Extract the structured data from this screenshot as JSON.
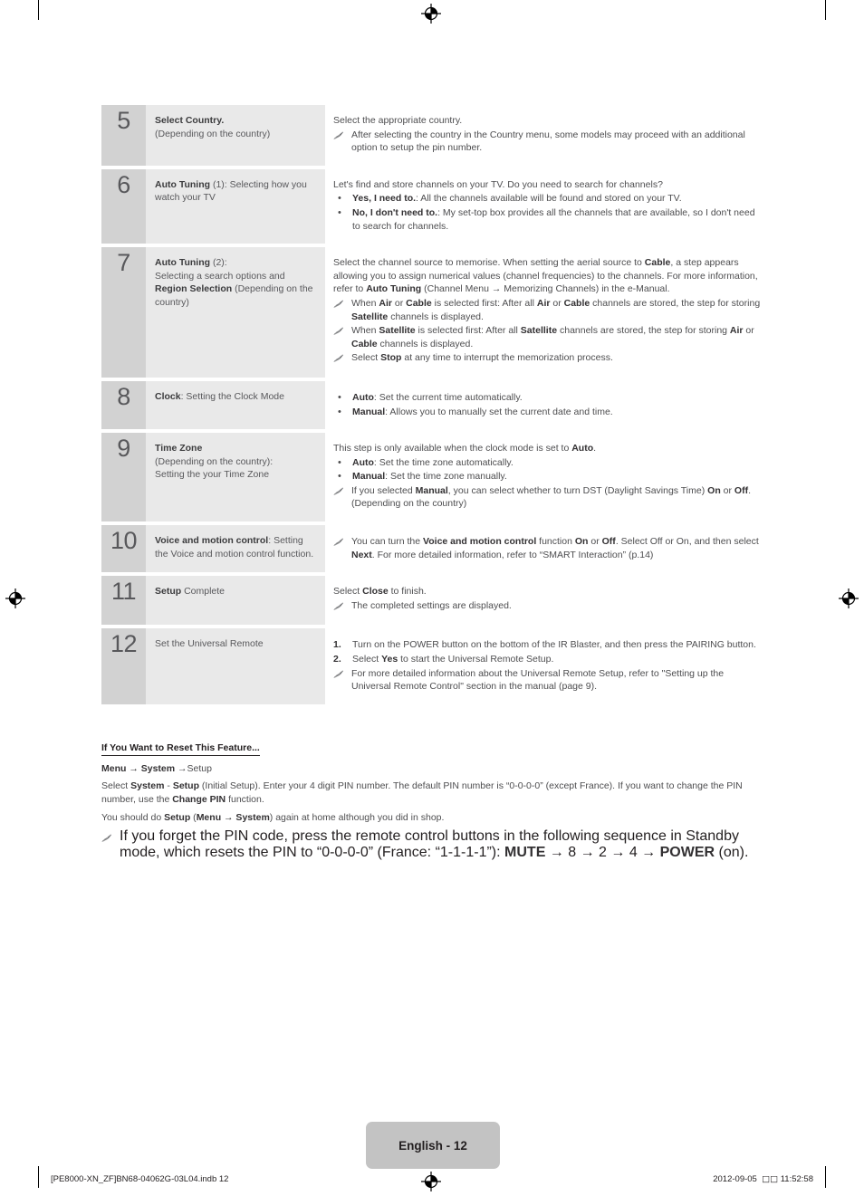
{
  "page": {
    "footer_tab_label": "English - 12",
    "footer_left": "[PE8000-XN_ZF]BN68-04062G-03L04.indb   12",
    "footer_right_date": "2012-09-05",
    "footer_right_tofu": "□□",
    "footer_right_time": "11:52:58"
  },
  "icons": {
    "note": "note-pencil-icon",
    "registration": "registration-mark-icon",
    "crop": "crop-mark-icon"
  },
  "steps": [
    {
      "number": "5",
      "label_lines": [
        {
          "bold": "Select Country.",
          "rest": ""
        },
        {
          "bold": "",
          "rest": "(Depending on the country)"
        }
      ],
      "desc": {
        "lead": "Select the appropriate country.",
        "notes": [
          "After selecting the country in the Country menu, some models may proceed with an additional option to setup the pin number."
        ]
      }
    },
    {
      "number": "6",
      "label_lines": [
        {
          "bold": "Auto Tuning",
          "rest": " (1): Selecting how you watch your TV"
        }
      ],
      "desc": {
        "lead": "Let's find and store channels on your TV. Do you need to search for channels?",
        "bullets": [
          {
            "bold": "Yes, I need to.",
            "rest": ": All the channels available will be found and stored on your TV."
          },
          {
            "bold": "No, I don't need to.",
            "rest": ": My set-top box provides all the channels that are available, so I don't need to search for channels."
          }
        ]
      }
    },
    {
      "number": "7",
      "label_lines": [
        {
          "bold": "Auto Tuning",
          "rest": " (2):"
        },
        {
          "bold": "",
          "rest": "Selecting a search options and"
        },
        {
          "bold": "Region Selection",
          "rest": " (Depending on the country)"
        }
      ],
      "desc": {
        "lead_html": "Select the channel source to memorise. When setting the aerial source to <b>Cable</b>, a step appears allowing you to assign numerical values (channel frequencies) to the channels. For more information, refer to <b>Auto Tuning</b> (Channel Menu → Memorizing Channels) in the e-Manual.",
        "notes_html": [
          "When <b>Air</b> or <b>Cable</b> is selected first: After all <b>Air</b> or <b>Cable</b> channels are stored, the step for storing <b>Satellite</b> channels is displayed.",
          "When <b>Satellite</b> is selected first: After all <b>Satellite</b> channels are stored, the step for storing <b>Air</b> or <b>Cable</b> channels is displayed.",
          "Select <b>Stop</b> at any time to interrupt the memorization process."
        ]
      }
    },
    {
      "number": "8",
      "label_lines": [
        {
          "bold": "Clock",
          "rest": ": Setting the Clock Mode"
        }
      ],
      "desc": {
        "bullets": [
          {
            "bold": "Auto",
            "rest": ": Set the current time automatically."
          },
          {
            "bold": "Manual",
            "rest": ": Allows you to manually set the current date and time."
          }
        ]
      }
    },
    {
      "number": "9",
      "label_lines": [
        {
          "bold": "Time Zone",
          "rest": ""
        },
        {
          "bold": "",
          "rest": "(Depending on the country):"
        },
        {
          "bold": "",
          "rest": "Setting the your Time Zone"
        }
      ],
      "desc": {
        "lead_html": "This step is only available when the clock mode is set to <b>Auto</b>.",
        "bullets": [
          {
            "bold": "Auto",
            "rest": ": Set the time zone automatically."
          },
          {
            "bold": "Manual",
            "rest": ": Set the time zone manually."
          }
        ],
        "notes_html": [
          "If you selected <b>Manual</b>, you can select whether to turn DST (Daylight Savings Time) <b>On</b> or <b>Off</b>. (Depending on the country)"
        ]
      }
    },
    {
      "number": "10",
      "label_lines": [
        {
          "bold": "Voice and motion control",
          "rest": ": Setting the Voice and motion control function."
        }
      ],
      "desc": {
        "notes_html": [
          "You can turn the <b>Voice and motion control</b> function <b>On</b> or <b>Off</b>. Select Off or On, and then select <b>Next</b>. For more detailed information, refer to “SMART Interaction” (p.14)"
        ]
      }
    },
    {
      "number": "11",
      "label_lines": [
        {
          "bold": "Setup",
          "rest": " Complete"
        }
      ],
      "desc": {
        "lead_html": "Select <b>Close</b> to finish.",
        "notes_html": [
          "The completed settings are displayed."
        ]
      }
    },
    {
      "number": "12",
      "label_lines": [
        {
          "bold": "",
          "rest": "Set the Universal Remote"
        }
      ],
      "desc": {
        "numbered": [
          {
            "mark": "1.",
            "html": "Turn on the POWER button on the bottom of the IR Blaster, and then press the PAIRING button."
          },
          {
            "mark": "2.",
            "html": "Select <b>Yes</b> to start the Universal Remote Setup."
          }
        ],
        "notes_html": [
          "For more detailed information about the Universal Remote Setup, refer to \"Setting up the Universal Remote Control\" section in the manual (page 9)."
        ]
      }
    }
  ],
  "reset_section": {
    "title": "If You Want to Reset This Feature...",
    "path_html": "<b>Menu → System</b> →Setup",
    "para1_html": "Select <b>System</b> - <b>Setup</b> (Initial Setup). Enter your 4 digit PIN number. The default PIN number is “0-0-0-0” (except France). If you want to change the PIN number, use the <b>Change PIN</b> function.",
    "para2_html": "You should do <b>Setup</b> (<b>Menu → System</b>) again at home although you did in shop.",
    "note_html": "If you forget the PIN code, press the remote control buttons in the following sequence in Standby mode, which resets the PIN to “0-0-0-0” (France: “1-1-1-1”): <b>MUTE</b> → 8 → 2 → 4 → <b>POWER</b> (on)."
  }
}
